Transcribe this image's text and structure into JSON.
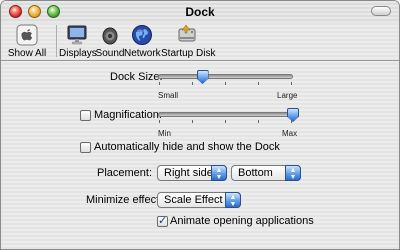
{
  "window": {
    "title": "Dock"
  },
  "toolbar": {
    "items": [
      {
        "label": "Show All",
        "icon": "apple-logo-icon"
      },
      {
        "label": "Displays",
        "icon": "display-icon"
      },
      {
        "label": "Sound",
        "icon": "speaker-icon"
      },
      {
        "label": "Network",
        "icon": "globe-icon"
      },
      {
        "label": "Startup Disk",
        "icon": "hard-disk-icon"
      }
    ]
  },
  "dock_size": {
    "label": "Dock Size:",
    "min_label": "Small",
    "max_label": "Large",
    "value": 0.33
  },
  "magnification": {
    "label": "Magnification:",
    "checked": false,
    "min_label": "Min",
    "max_label": "Max",
    "value": 1.0
  },
  "autohide": {
    "label": "Automatically hide and show the Dock",
    "checked": false
  },
  "placement": {
    "label": "Placement:",
    "options_selected": [
      "Right side",
      "Bottom"
    ]
  },
  "minimize_effect": {
    "label": "Minimize effect:",
    "selected": "Scale Effect"
  },
  "animate": {
    "label": "Animate opening applications",
    "checked": true
  },
  "colors": {
    "accent": "#5e9fe8",
    "accent_dark": "#2c6ad0"
  }
}
